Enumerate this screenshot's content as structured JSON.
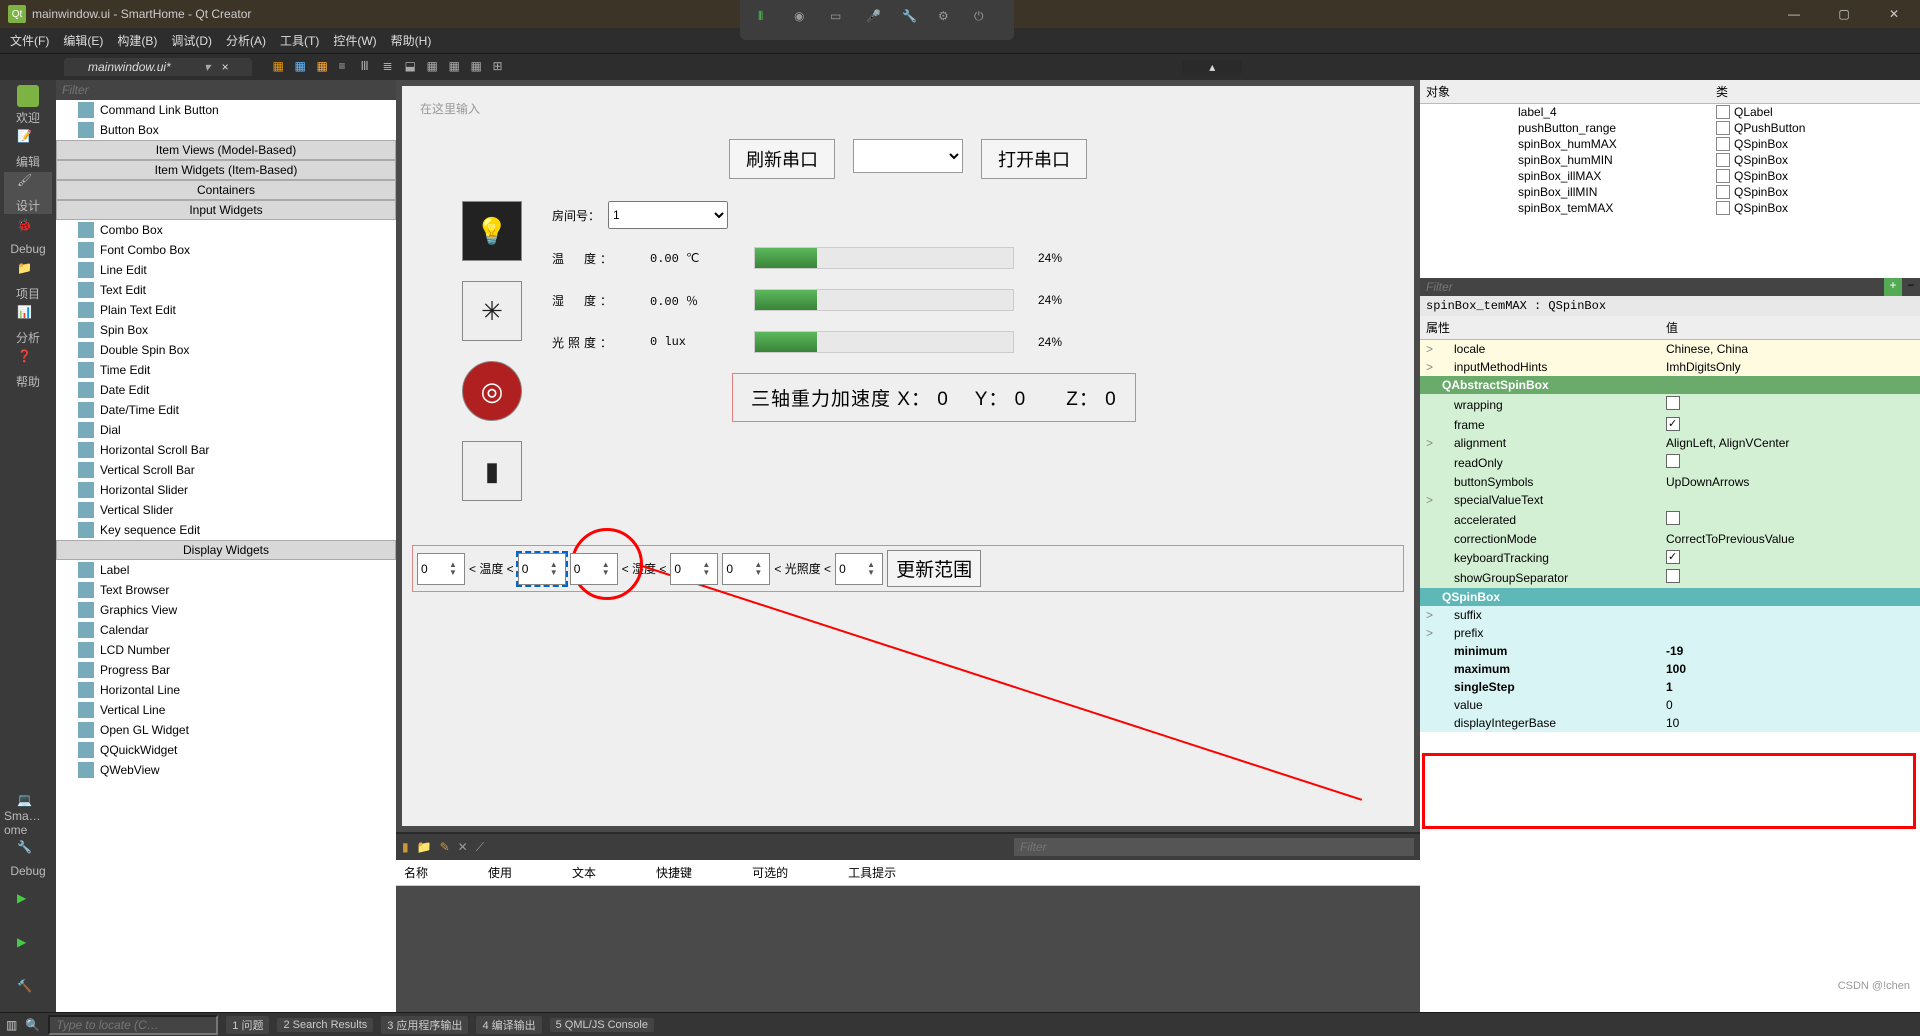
{
  "title": "mainwindow.ui - SmartHome - Qt Creator",
  "menu": [
    "文件(F)",
    "编辑(E)",
    "构建(B)",
    "调试(D)",
    "分析(A)",
    "工具(T)",
    "控件(W)",
    "帮助(H)"
  ],
  "tab": {
    "name": "mainwindow.ui*",
    "close": "×"
  },
  "leftbar": [
    {
      "label": "欢迎"
    },
    {
      "label": "编辑"
    },
    {
      "label": "设计"
    },
    {
      "label": "Debug"
    },
    {
      "label": "项目"
    },
    {
      "label": "分析"
    },
    {
      "label": "帮助"
    }
  ],
  "leftbar_bottom": [
    {
      "label": "Sma…ome"
    },
    {
      "label": "Debug"
    }
  ],
  "widget_filter": "Filter",
  "widget_groups": [
    {
      "items": [
        {
          "name": "Command Link Button"
        },
        {
          "name": "Button Box"
        }
      ]
    },
    {
      "hdr": "Item Views (Model-Based)"
    },
    {
      "hdr": "Item Widgets (Item-Based)"
    },
    {
      "hdr": "Containers"
    },
    {
      "hdr": "Input Widgets",
      "items": [
        {
          "name": "Combo Box"
        },
        {
          "name": "Font Combo Box"
        },
        {
          "name": "Line Edit"
        },
        {
          "name": "Text Edit"
        },
        {
          "name": "Plain Text Edit"
        },
        {
          "name": "Spin Box"
        },
        {
          "name": "Double Spin Box"
        },
        {
          "name": "Time Edit"
        },
        {
          "name": "Date Edit"
        },
        {
          "name": "Date/Time Edit"
        },
        {
          "name": "Dial"
        },
        {
          "name": "Horizontal Scroll Bar"
        },
        {
          "name": "Vertical Scroll Bar"
        },
        {
          "name": "Horizontal Slider"
        },
        {
          "name": "Vertical Slider"
        },
        {
          "name": "Key sequence Edit"
        }
      ]
    },
    {
      "hdr": "Display Widgets",
      "items": [
        {
          "name": "Label"
        },
        {
          "name": "Text Browser"
        },
        {
          "name": "Graphics View"
        },
        {
          "name": "Calendar"
        },
        {
          "name": "LCD Number"
        },
        {
          "name": "Progress Bar"
        },
        {
          "name": "Horizontal Line"
        },
        {
          "name": "Vertical Line"
        },
        {
          "name": "Open GL Widget"
        },
        {
          "name": "QQuickWidget"
        },
        {
          "name": "QWebView"
        }
      ]
    }
  ],
  "form": {
    "placeholder": "在这里输入",
    "refresh_btn": "刷新串口",
    "open_btn": "打开串口",
    "room_lbl": "房间号：",
    "room_val": "1",
    "rows": [
      {
        "lbl": "温　度：",
        "val": "0.00 ℃",
        "pct": "24%"
      },
      {
        "lbl": "湿　度：",
        "val": "0.00 ％",
        "pct": "24%"
      },
      {
        "lbl": "光照度：",
        "val": "0 lux",
        "pct": "24%"
      }
    ],
    "accel": "三轴重力加速度 X： 0　 Y： 0　　Z： 0",
    "range": {
      "v": [
        "0",
        "0",
        "0",
        "0",
        "0",
        "0"
      ],
      "l": [
        "< 温度 <",
        "< 湿度 <",
        "< 光照度 <"
      ],
      "update": "更新范围"
    }
  },
  "bottom": {
    "filter": "Filter",
    "cols": [
      "名称",
      "使用",
      "文本",
      "快捷键",
      "可选的",
      "工具提示"
    ]
  },
  "obj_hdr": [
    "对象",
    "类"
  ],
  "objects": [
    {
      "n": "label_4",
      "c": "QLabel"
    },
    {
      "n": "pushButton_range",
      "c": "QPushButton"
    },
    {
      "n": "spinBox_humMAX",
      "c": "QSpinBox"
    },
    {
      "n": "spinBox_humMIN",
      "c": "QSpinBox"
    },
    {
      "n": "spinBox_illMAX",
      "c": "QSpinBox"
    },
    {
      "n": "spinBox_illMIN",
      "c": "QSpinBox"
    },
    {
      "n": "spinBox_temMAX",
      "c": "QSpinBox"
    }
  ],
  "prop_filter": "Filter",
  "prop_selected": "spinBox_temMAX : QSpinBox",
  "prop_hdr": [
    "属性",
    "值"
  ],
  "props": [
    {
      "g": "y",
      "n": "locale",
      "v": "Chinese, China",
      "chev": ">"
    },
    {
      "g": "y",
      "n": "inputMethodHints",
      "v": "ImhDigitsOnly",
      "chev": ">"
    },
    {
      "g": "gh",
      "n": "QAbstractSpinBox",
      "v": ""
    },
    {
      "g": "g",
      "n": "wrapping",
      "v": "",
      "chk": false
    },
    {
      "g": "g",
      "n": "frame",
      "v": "",
      "chk": true
    },
    {
      "g": "g",
      "n": "alignment",
      "v": "AlignLeft, AlignVCenter",
      "chev": ">"
    },
    {
      "g": "g",
      "n": "readOnly",
      "v": "",
      "chk": false
    },
    {
      "g": "g",
      "n": "buttonSymbols",
      "v": "UpDownArrows"
    },
    {
      "g": "g",
      "n": "specialValueText",
      "v": "",
      "chev": ">"
    },
    {
      "g": "g",
      "n": "accelerated",
      "v": "",
      "chk": false
    },
    {
      "g": "g",
      "n": "correctionMode",
      "v": "CorrectToPreviousValue"
    },
    {
      "g": "g",
      "n": "keyboardTracking",
      "v": "",
      "chk": true
    },
    {
      "g": "g",
      "n": "showGroupSeparator",
      "v": "",
      "chk": false
    },
    {
      "g": "ch",
      "n": "QSpinBox",
      "v": ""
    },
    {
      "g": "c",
      "n": "suffix",
      "v": "",
      "chev": ">"
    },
    {
      "g": "c",
      "n": "prefix",
      "v": "",
      "chev": ">"
    },
    {
      "g": "c",
      "n": "minimum",
      "v": "-19",
      "hl": true
    },
    {
      "g": "c",
      "n": "maximum",
      "v": "100",
      "hl": true
    },
    {
      "g": "c",
      "n": "singleStep",
      "v": "1",
      "hl": true
    },
    {
      "g": "c",
      "n": "value",
      "v": "0"
    },
    {
      "g": "c",
      "n": "displayIntegerBase",
      "v": "10"
    }
  ],
  "status": {
    "locate": "Type to locate (C…",
    "items": [
      "1 问题",
      "2 Search Results",
      "3 应用程序输出",
      "4 编译输出",
      "5 QML/JS Console"
    ]
  },
  "watermark": "CSDN @!chen"
}
